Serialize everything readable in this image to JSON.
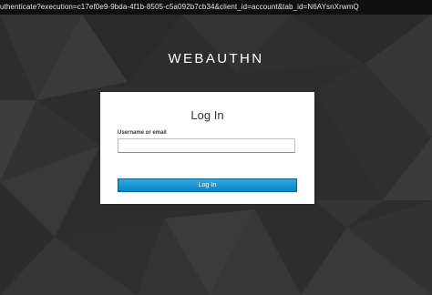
{
  "browser": {
    "url_text": "uthenticate?execution=c17ef0e9-9bda-4f1b-8505-c5a092b7cb34&client_id=account&tab_id=N6AYsnXrwmQ"
  },
  "brand": {
    "name": "WEBAUTHN"
  },
  "login": {
    "title": "Log In",
    "username_label": "Username or email",
    "username_value": "",
    "submit_label": "Log In"
  },
  "colors": {
    "background": "#2e2e2e",
    "button": "#0088ce",
    "card": "#ffffff"
  }
}
